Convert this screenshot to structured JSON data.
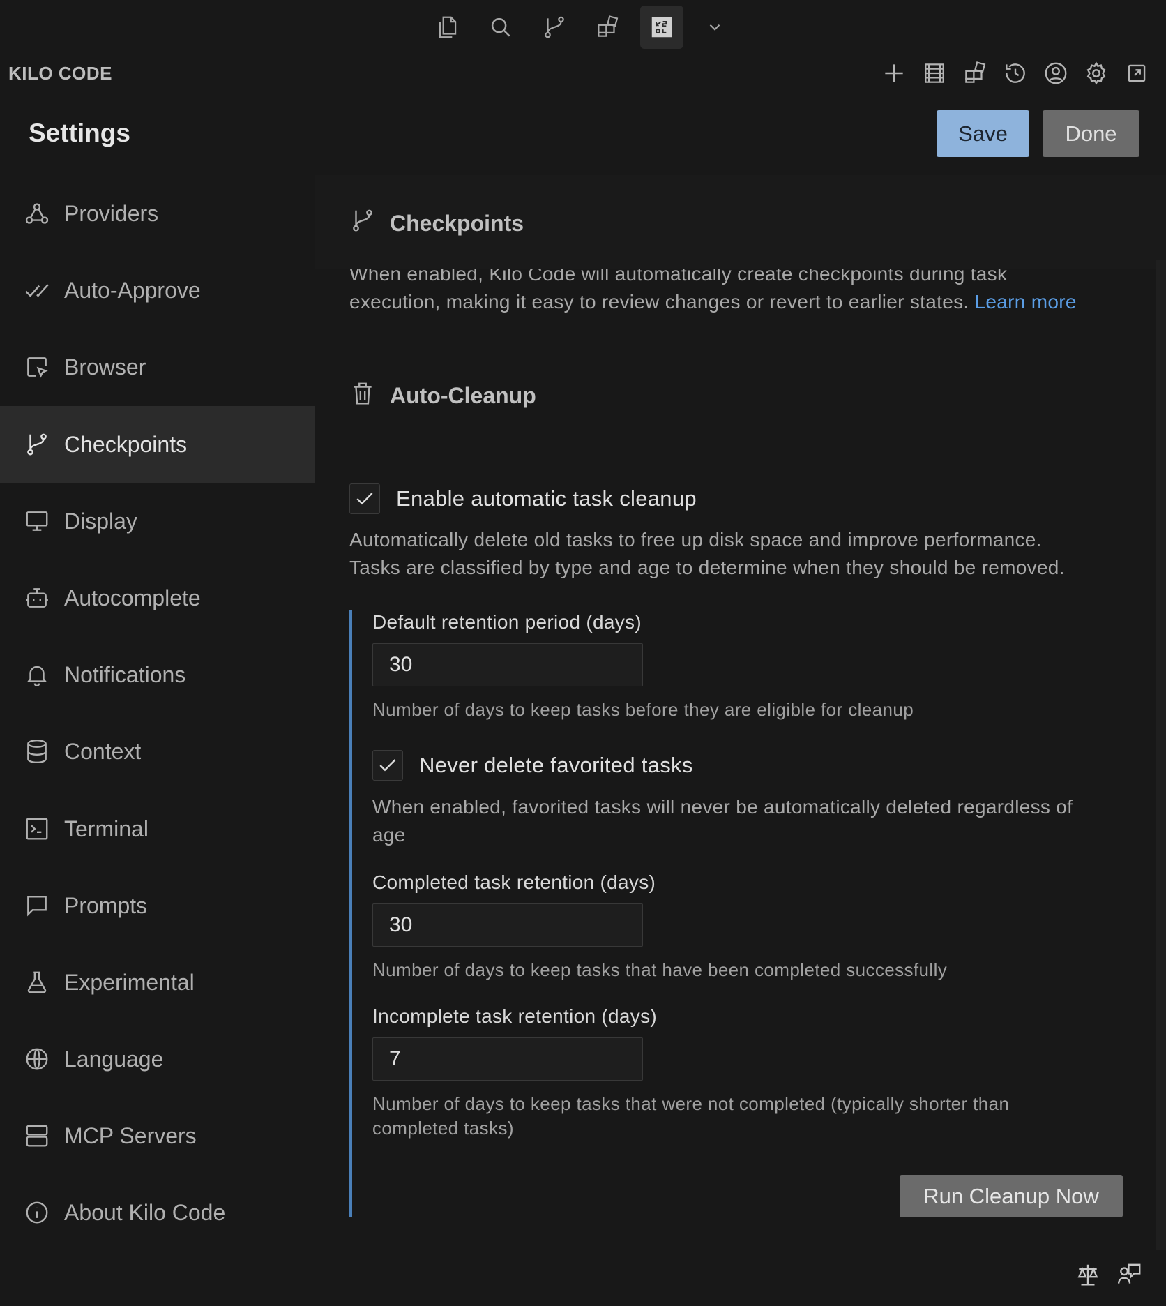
{
  "panel": {
    "title": "KILO CODE"
  },
  "settings": {
    "title": "Settings",
    "save_label": "Save",
    "done_label": "Done"
  },
  "sidebar": {
    "items": [
      {
        "label": "Providers",
        "icon": "webhook-icon"
      },
      {
        "label": "Auto-Approve",
        "icon": "check-check-icon"
      },
      {
        "label": "Browser",
        "icon": "browser-pointer-icon"
      },
      {
        "label": "Checkpoints",
        "icon": "git-branch-icon",
        "active": true
      },
      {
        "label": "Display",
        "icon": "monitor-icon"
      },
      {
        "label": "Autocomplete",
        "icon": "bot-icon"
      },
      {
        "label": "Notifications",
        "icon": "bell-icon"
      },
      {
        "label": "Context",
        "icon": "database-icon"
      },
      {
        "label": "Terminal",
        "icon": "terminal-icon"
      },
      {
        "label": "Prompts",
        "icon": "message-square-icon"
      },
      {
        "label": "Experimental",
        "icon": "flask-icon"
      },
      {
        "label": "Language",
        "icon": "globe-icon"
      },
      {
        "label": "MCP Servers",
        "icon": "server-icon"
      },
      {
        "label": "About Kilo Code",
        "icon": "info-icon"
      }
    ]
  },
  "content": {
    "section_title": "Checkpoints",
    "description_line1": "When enabled, Kilo Code will automatically create checkpoints during task",
    "description_line2": "execution, making it easy to review changes or revert to earlier states.",
    "learn_more": "Learn more",
    "cleanup_title": "Auto-Cleanup",
    "enable_cleanup_label": "Enable automatic task cleanup",
    "enable_cleanup_checked": true,
    "cleanup_desc_line1": "Automatically delete old tasks to free up disk space and improve performance.",
    "cleanup_desc_line2": "Tasks are classified by type and age to determine when they should be removed.",
    "default_retention": {
      "label": "Default retention period (days)",
      "value": "30",
      "help": "Number of days to keep tasks before they are eligible for cleanup"
    },
    "never_delete_favorites": {
      "label": "Never delete favorited tasks",
      "checked": true,
      "help_line1": "When enabled, favorited tasks will never be automatically deleted regardless of",
      "help_line2": "age"
    },
    "completed_retention": {
      "label": "Completed task retention (days)",
      "value": "30",
      "help": "Number of days to keep tasks that have been completed successfully"
    },
    "incomplete_retention": {
      "label": "Incomplete task retention (days)",
      "value": "7",
      "help_line1": "Number of days to keep tasks that were not completed (typically shorter than",
      "help_line2": "completed tasks)"
    },
    "run_cleanup_label": "Run Cleanup Now"
  },
  "colors": {
    "accent": "#8eb3dc",
    "link": "#5b9ee6",
    "bar": "#4a7fb8",
    "background": "#181818"
  }
}
